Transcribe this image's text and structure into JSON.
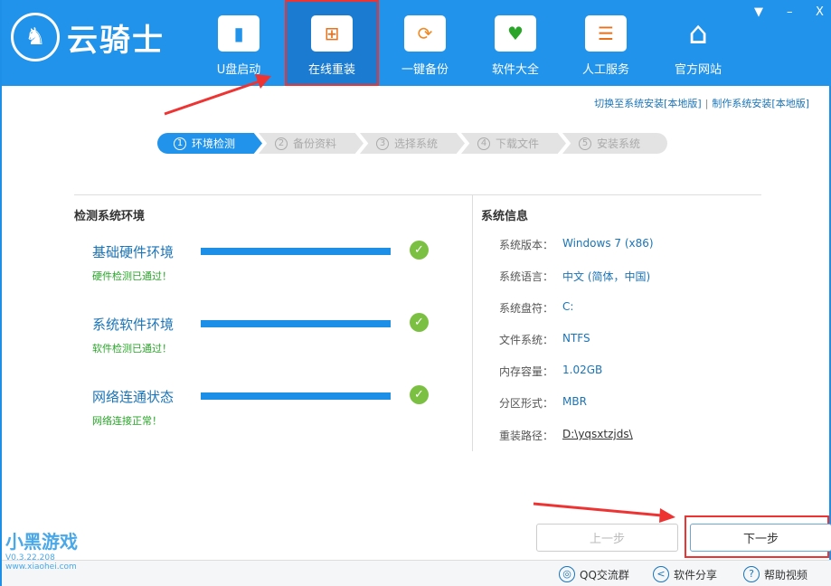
{
  "app": {
    "name": "云骑士"
  },
  "nav": [
    {
      "label": "U盘启动",
      "icon": "usb-icon"
    },
    {
      "label": "在线重装",
      "icon": "monitor-windows-icon"
    },
    {
      "label": "一键备份",
      "icon": "backup-icon"
    },
    {
      "label": "软件大全",
      "icon": "software-box-icon"
    },
    {
      "label": "人工服务",
      "icon": "chat-icon"
    },
    {
      "label": "官方网站",
      "icon": "home-icon"
    }
  ],
  "window": {
    "menu": "▼",
    "min": "–",
    "close": "X"
  },
  "links": {
    "switch": "切换至系统安装[本地版]",
    "sep": "|",
    "make": "制作系统安装[本地版]"
  },
  "steps": [
    {
      "n": "1",
      "label": "环境检测"
    },
    {
      "n": "2",
      "label": "备份资料"
    },
    {
      "n": "3",
      "label": "选择系统"
    },
    {
      "n": "4",
      "label": "下载文件"
    },
    {
      "n": "5",
      "label": "安装系统"
    }
  ],
  "env": {
    "title": "检测系统环境",
    "items": [
      {
        "name": "基础硬件环境",
        "status": "硬件检测已通过！",
        "progress": 100
      },
      {
        "name": "系统软件环境",
        "status": "软件检测已通过！",
        "progress": 100
      },
      {
        "name": "网络连通状态",
        "status": "网络连接正常！",
        "progress": 100
      }
    ]
  },
  "sysinfo": {
    "title": "系统信息",
    "rows": [
      {
        "k": "系统版本：",
        "v": "Windows 7 (x86)"
      },
      {
        "k": "系统语言：",
        "v": "中文 (简体，中国)"
      },
      {
        "k": "系统盘符：",
        "v": "C:"
      },
      {
        "k": "文件系统：",
        "v": "NTFS"
      },
      {
        "k": "内存容量：",
        "v": "1.02GB"
      },
      {
        "k": "分区形式：",
        "v": "MBR"
      },
      {
        "k": "重装路径：",
        "v": "D:\\yqsxtzjds\\"
      }
    ]
  },
  "buttons": {
    "prev": "上一步",
    "next": "下一步"
  },
  "footer": {
    "qq": "QQ交流群",
    "share": "软件分享",
    "help": "帮助视频"
  },
  "watermark": {
    "text": "小黑游戏",
    "url": "www.xiaohei.com",
    "version": "V0.3.22.208"
  }
}
